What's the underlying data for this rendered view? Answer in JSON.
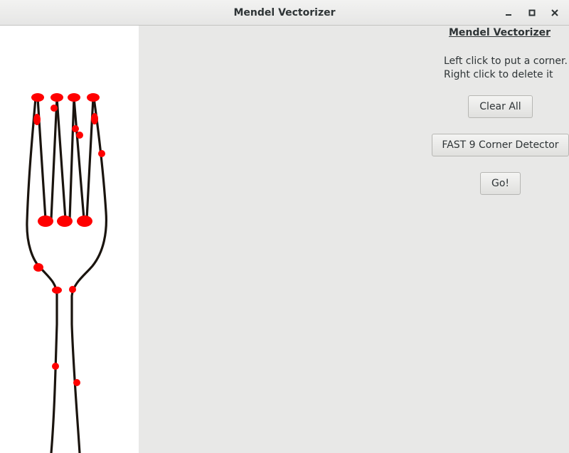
{
  "window": {
    "title": "Mendel Vectorizer",
    "controls": {
      "minimize_icon": "minimize-icon",
      "maximize_icon": "maximize-icon",
      "close_icon": "close-icon"
    }
  },
  "panel": {
    "heading": "Mendel Vectorizer",
    "instructions": [
      "Left click to put a corner.",
      "Right click to delete it"
    ],
    "buttons": {
      "clear": "Clear All",
      "detector": "FAST 9 Corner Detector",
      "go": "Go!"
    }
  },
  "canvas": {
    "image_subject": "fork",
    "stroke_color": "#1a140e",
    "corner_color": "#ff0000"
  }
}
